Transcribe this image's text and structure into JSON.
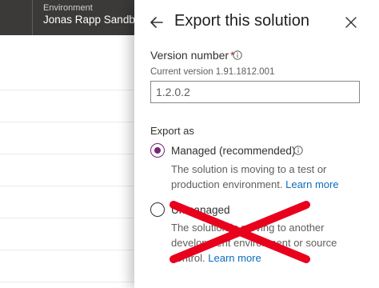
{
  "environment": {
    "label": "Environment",
    "name": "Jonas Rapp Sandbox"
  },
  "panel": {
    "title": "Export this solution",
    "version": {
      "label": "Version number",
      "required_mark": "*",
      "current": "Current version 1.91.1812.001",
      "value": "1.2.0.2"
    },
    "export_as": {
      "label": "Export as",
      "options": [
        {
          "label": "Managed (recommended)",
          "checked": true,
          "desc": "The solution is moving to a test or production environment.",
          "link": "Learn more"
        },
        {
          "label": "Unmanaged",
          "checked": false,
          "desc": "The solution is moving to another development environment or source control.",
          "link": "Learn more"
        }
      ]
    }
  },
  "colors": {
    "accent": "#742774",
    "link": "#0f6cbd",
    "topbar": "#3b3a39",
    "cross_out": "#e8001c"
  },
  "icons": [
    "back-arrow-icon",
    "close-icon",
    "info-icon",
    "radio-button",
    "red-x-overlay"
  ]
}
